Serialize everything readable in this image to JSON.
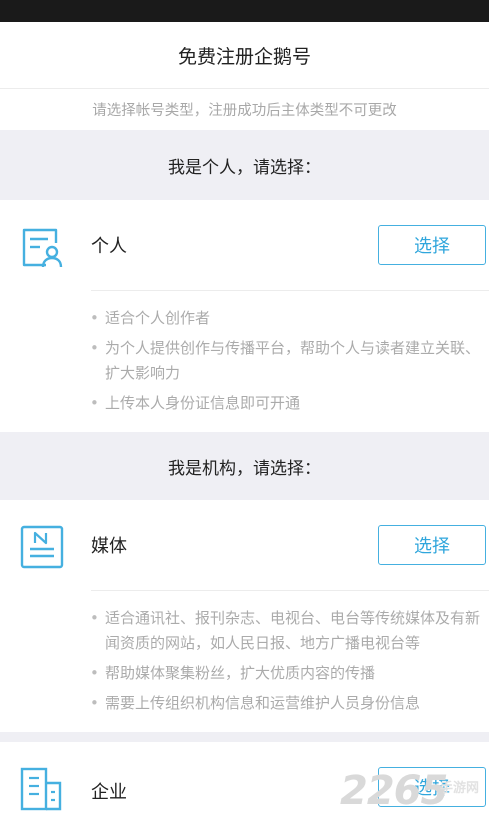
{
  "header": {
    "title": "免费注册企鹅号"
  },
  "subtitle": "请选择帐号类型，注册成功后主体类型不可更改",
  "sections": [
    {
      "heading": "我是个人，请选择：",
      "option": {
        "label": "个人",
        "icon": "person-document-icon",
        "button": "选择",
        "bullets": [
          "适合个人创作者",
          "为个人提供创作与传播平台，帮助个人与读者建立关联、扩大影响力",
          "上传本人身份证信息即可开通"
        ]
      }
    },
    {
      "heading": "我是机构，请选择：",
      "option": {
        "label": "媒体",
        "icon": "newspaper-icon",
        "button": "选择",
        "bullets": [
          "适合通讯社、报刊杂志、电视台、电台等传统媒体及有新闻资质的网站，如人民日报、地方广播电视台等",
          "帮助媒体聚集粉丝，扩大优质内容的传播",
          "需要上传组织机构信息和运营维护人员身份信息"
        ]
      }
    }
  ],
  "enterprise": {
    "label": "企业",
    "icon": "building-icon",
    "button": "选择"
  },
  "watermark": {
    "number": "2265",
    "text": "手游网"
  },
  "colors": {
    "accent": "#2fa6dc",
    "section_bg": "#efeff4",
    "muted_text": "#ababab"
  }
}
